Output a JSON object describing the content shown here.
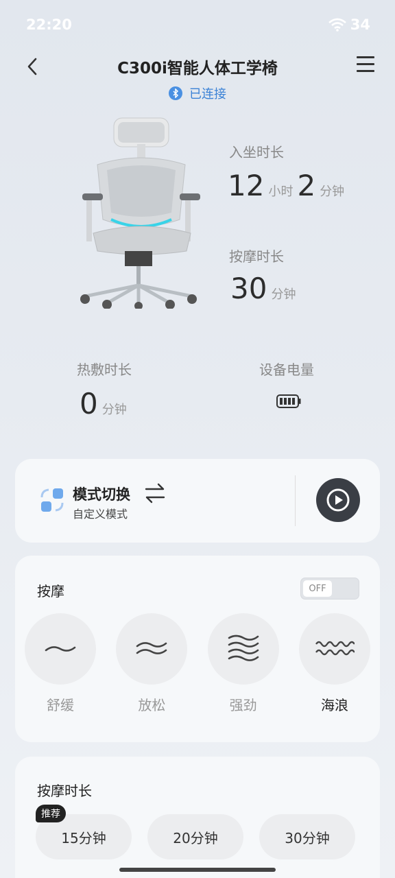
{
  "status": {
    "time": "22:20",
    "battery": "34"
  },
  "header": {
    "title": "C300i智能人体工学椅",
    "connection": "已连接"
  },
  "stats": {
    "sitting": {
      "label": "入坐时长",
      "hours": "12",
      "hours_unit": "小时",
      "minutes": "2",
      "minutes_unit": "分钟"
    },
    "massage": {
      "label": "按摩时长",
      "minutes": "30",
      "unit": "分钟"
    },
    "heating": {
      "label": "热敷时长",
      "minutes": "0",
      "unit": "分钟"
    },
    "battery": {
      "label": "设备电量"
    }
  },
  "mode": {
    "title": "模式切换",
    "subtitle": "自定义模式"
  },
  "massage": {
    "title": "按摩",
    "toggle": "OFF",
    "modes": [
      {
        "label": "舒缓"
      },
      {
        "label": "放松"
      },
      {
        "label": "强劲"
      },
      {
        "label": "海浪",
        "active": true
      }
    ]
  },
  "duration": {
    "title": "按摩时长",
    "badge": "推荐",
    "options": [
      "15分钟",
      "20分钟",
      "30分钟"
    ]
  }
}
